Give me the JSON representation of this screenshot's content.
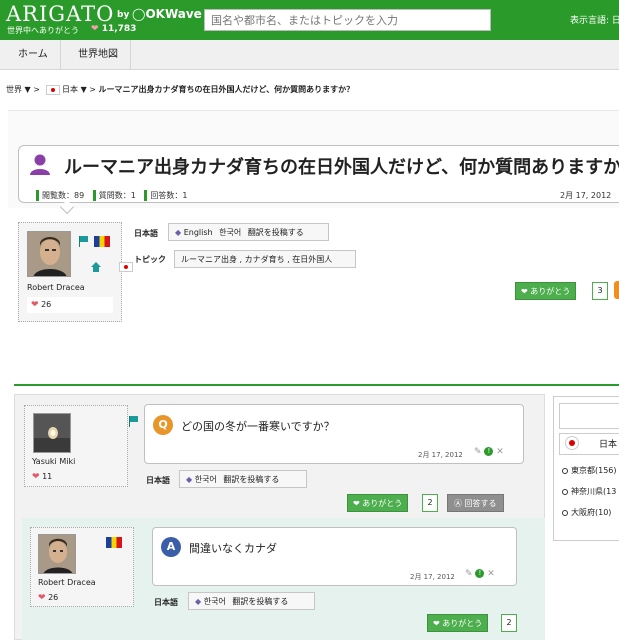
{
  "header": {
    "logo": "ARIGATO",
    "by": "by",
    "okwave": "OKWave",
    "tagline": "世界中へありがとう",
    "heart_count": "11,783",
    "search_placeholder": "国名や都市名、またはトピックを入力",
    "language_label": "表示言語: 日"
  },
  "nav": {
    "home": "ホーム",
    "world_map": "世界地図"
  },
  "breadcrumb": {
    "world": "世界 ▼ >",
    "country": "日本 ▼ >",
    "current": "ルーマニア出身カナダ育ちの在日外国人だけど、何か質問ありますか？"
  },
  "question": {
    "title": "ルーマニア出身カナダ育ちの在日外国人だけど、何か質問ありますか？",
    "views": "閲覧数：89",
    "questions": "質問数：1",
    "answers": "回答数：1",
    "date": "2月 17, 2012",
    "author": {
      "name": "Robert Dracea",
      "hearts": "26"
    },
    "language_label": "日本語",
    "language_tabs": [
      "English",
      "한국어",
      "翻訳を投稿する"
    ],
    "topic_label": "トピック",
    "topics": "ルーマニア出身 , カナダ育ち , 在日外国人",
    "thanks_label": "ありがとう",
    "thanks_count": "3"
  },
  "qa": {
    "q_badge": "Q",
    "q_text": "どの国の冬が一番寒いですか？",
    "q_date": "2月 17, 2012",
    "q_author": {
      "name": "Yasuki Miki",
      "hearts": "11"
    },
    "q_language_label": "日本語",
    "q_language_tabs": [
      "한국어",
      "翻訳を投稿する"
    ],
    "q_thanks_label": "ありがとう",
    "q_thanks_count": "2",
    "answer_button": "回答する",
    "a_badge": "A",
    "a_text": "間違いなくカナダ",
    "a_date": "2月 17, 2012",
    "a_author": {
      "name": "Robert Dracea",
      "hearts": "26"
    },
    "a_language_label": "日本語",
    "a_language_tabs": [
      "한국어",
      "翻訳を投稿する"
    ],
    "a_thanks_label": "ありがとう",
    "a_thanks_count": "2"
  },
  "sidebar": {
    "country": "日本",
    "items": [
      "東京都(156)",
      "神奈川県(13",
      "大阪府(10)"
    ]
  },
  "colors": {
    "brand_green": "#2a9b2a",
    "heart_pink": "#e05a6a",
    "q_orange": "#e8952a",
    "a_blue": "#3a5fa8"
  }
}
